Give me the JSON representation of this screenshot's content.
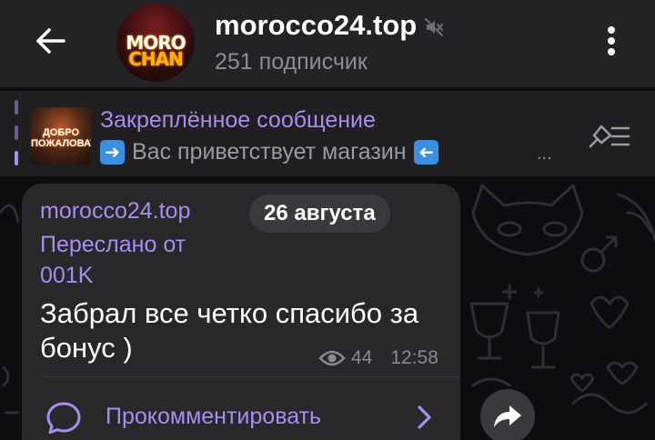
{
  "header": {
    "back_icon": "arrow-left-icon",
    "avatar_logo_line1": "MORO",
    "avatar_logo_line2": "CHAN",
    "title": "morocco24.top",
    "muted_icon": "speaker-muted-icon",
    "subscribers": "251 подписчик",
    "menu_icon": "more-vertical-icon"
  },
  "pinned": {
    "thumb_line1": "ДОБРО",
    "thumb_line2": "ПОЖАЛОВАТЬ",
    "title": "Закреплённое сообщение",
    "text": "Вас приветствует магазин",
    "ellipsis": "...",
    "list_icon": "pinned-list-icon"
  },
  "message": {
    "author": "morocco24.top",
    "forwarded_label": "Переслано от",
    "forwarded_from": "001K",
    "date": "26 августа",
    "text": "Забрал все четко спасибо за бонус )",
    "views": "44",
    "time": "12:58",
    "comment_label": "Прокомментировать"
  },
  "colors": {
    "accent": "#a88df0",
    "header_bg": "#232325",
    "bubble_bg": "#28282b",
    "chat_bg": "#0d0d0f"
  }
}
